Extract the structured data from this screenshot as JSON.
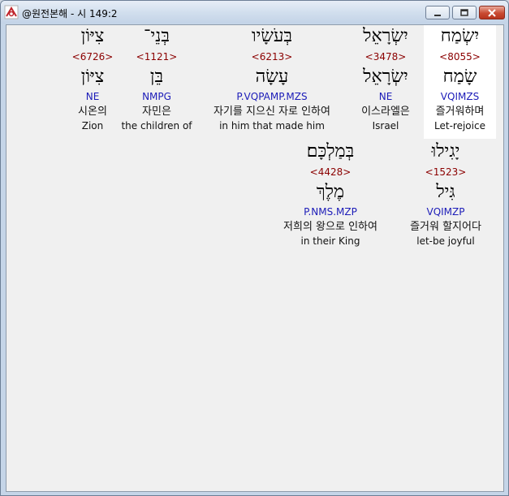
{
  "window": {
    "title": "@원전본해 - 시 149:2",
    "buttons": {
      "minimize": "minimize-icon",
      "maximize": "maximize-icon",
      "close": "close-icon"
    }
  },
  "words": [
    {
      "surface": "יִשְׂמַח",
      "strong": "<8055>",
      "lemma": "שָׂמַח",
      "morph": "VQIMZS",
      "korean": "즐거워하며",
      "english": "Let-rejoice",
      "highlighted": true
    },
    {
      "surface": "יִשְׂרָאֵל",
      "strong": "<3478>",
      "lemma": "יִשְׂרָאֵל",
      "morph": "NE",
      "korean": "이스라엘은",
      "english": "Israel",
      "highlighted": false
    },
    {
      "surface": "בְּעֹשָׂיו",
      "strong": "<6213>",
      "lemma": "עָשָׂה",
      "morph": "P.VQPAMP.MZS",
      "korean": "자기를 지으신 자로 인하여",
      "english": "in him that made him",
      "highlighted": false
    },
    {
      "surface": "בְּנֵי־",
      "strong": "<1121>",
      "lemma": "בֵּן",
      "morph": "NMPG",
      "korean": "자민은",
      "english": "the children of",
      "highlighted": false
    },
    {
      "surface": "צִיּוֹן",
      "strong": "<6726>",
      "lemma": "צִיּוֹן",
      "morph": "NE",
      "korean": "시온의",
      "english": "Zion",
      "highlighted": false
    },
    {
      "surface": "יָגִילוּ",
      "strong": "<1523>",
      "lemma": "גִּיל",
      "morph": "VQIMZP",
      "korean": "즐거워 할지어다",
      "english": "let-be joyful",
      "highlighted": false
    },
    {
      "surface": "בְּמַלְכָּם׃",
      "strong": "<4428>",
      "lemma": "מֶלֶךְ",
      "morph": "P.NMS.MZP",
      "korean": "저희의 왕으로 인하여",
      "english": "in their King",
      "highlighted": false
    }
  ]
}
